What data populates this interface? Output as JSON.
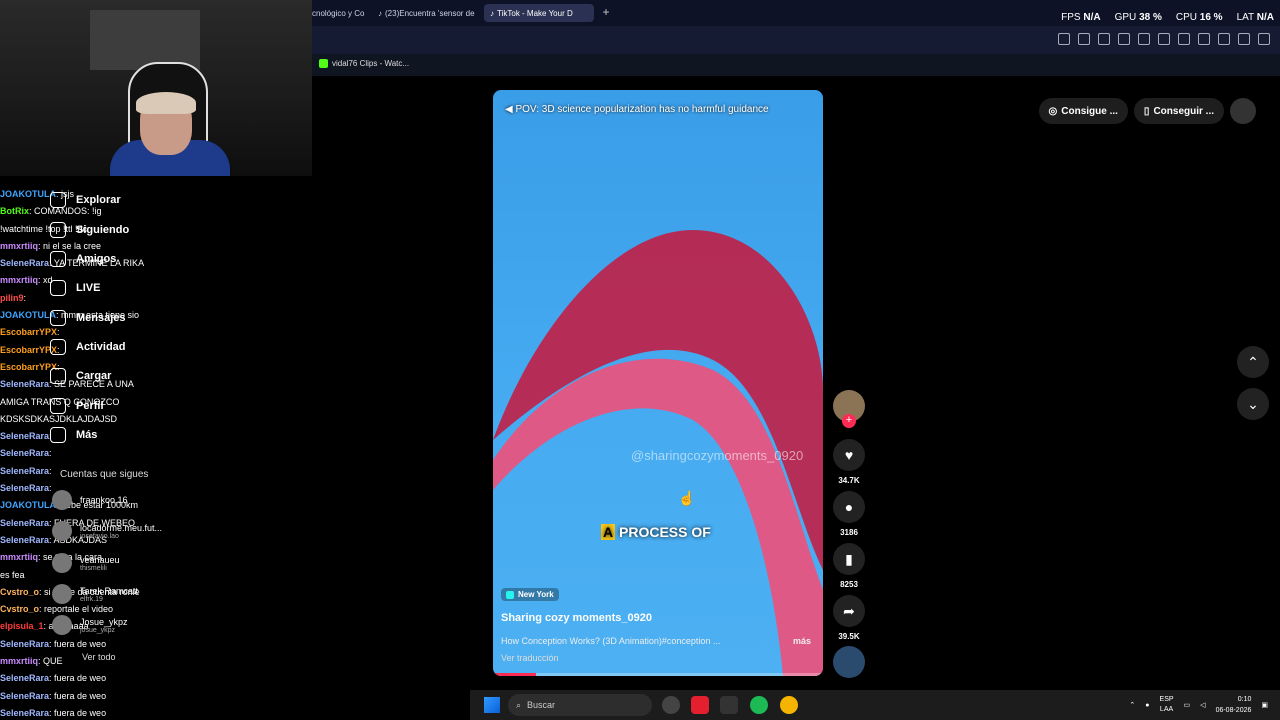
{
  "browser": {
    "tabs": [
      {
        "label": "cnológico y Co"
      },
      {
        "label": "(23)Encuentra 'sensor de"
      },
      {
        "label": "TikTok - Make Your D"
      }
    ],
    "stats": {
      "fps_label": "FPS",
      "fps": "N/A",
      "gpu_label": "GPU",
      "gpu": "38 %",
      "cpu_label": "CPU",
      "cpu": "16 %",
      "lat_label": "LAT",
      "lat": "N/A"
    },
    "bookmark": "vidal76 Clips - Watc..."
  },
  "chat": [
    {
      "user": "JOAKOTULA",
      "color": "#3fa6ff",
      "text": ": jsjs"
    },
    {
      "user": "BotRix",
      "color": "#53fc18",
      "text": ": COMANDOS: !ig"
    },
    {
      "user": "",
      "color": "#fff",
      "text": "!watchtime !top !ttl !dc"
    },
    {
      "user": "mmxrtiiq",
      "color": "#c98bff",
      "text": ": ni el se la cree"
    },
    {
      "user": "SeleneRara",
      "color": "#9fb8ff",
      "text": ": YA TERMINE LA RIKA"
    },
    {
      "user": "mmxrtiiq",
      "color": "#c98bff",
      "text": ": xd"
    },
    {
      "user": "pilin9",
      "color": "#ff4d4d",
      "text": ":"
    },
    {
      "user": "JOAKOTULA",
      "color": "#3fa6ff",
      "text": ": mmm esta tiene sio"
    },
    {
      "user": "EscobarrYPX",
      "color": "#ff9f1a",
      "text": ":"
    },
    {
      "user": "EscobarrYPX",
      "color": "#ff9f1a",
      "text": ":"
    },
    {
      "user": "EscobarrYPX",
      "color": "#ff9f1a",
      "text": ":"
    },
    {
      "user": "SeleneRara",
      "color": "#9fb8ff",
      "text": ": SE PARECE A UNA"
    },
    {
      "user": "",
      "color": "#fff",
      "text": "AMIGA TRANS Q CONOZCO"
    },
    {
      "user": "",
      "color": "#fff",
      "text": "KDSKSDKASJDKLAJDAJSD"
    },
    {
      "user": "SeleneRara",
      "color": "#9fb8ff",
      "text": ":"
    },
    {
      "user": "SeleneRara",
      "color": "#9fb8ff",
      "text": ":"
    },
    {
      "user": "SeleneRara",
      "color": "#9fb8ff",
      "text": ":"
    },
    {
      "user": "SeleneRara",
      "color": "#9fb8ff",
      "text": ":"
    },
    {
      "user": "JOAKOTULA",
      "color": "#3fa6ff",
      "text": ": debe estar 1000km"
    },
    {
      "user": "SeleneRara",
      "color": "#9fb8ff",
      "text": ": FUERA DE WEBEO"
    },
    {
      "user": "SeleneRara",
      "color": "#9fb8ff",
      "text": ": ASDKAJDAS"
    },
    {
      "user": "mmxrtiiq",
      "color": "#c98bff",
      "text": ": se tapa la cara"
    },
    {
      "user": "",
      "color": "#fff",
      "text": "es fea"
    },
    {
      "user": "Cvstro_o",
      "color": "#ffb35c",
      "text": ": si no se da cuenta ronie"
    },
    {
      "user": "Cvstro_o",
      "color": "#ffb35c",
      "text": ": reportale el video"
    },
    {
      "user": "elpisula_1",
      "color": "#ff3b3b",
      "text": ": aaaaaaaa"
    },
    {
      "user": "SeleneRara",
      "color": "#9fb8ff",
      "text": ": fuera de weo"
    },
    {
      "user": "mmxrtiiq",
      "color": "#c98bff",
      "text": ": QUE"
    },
    {
      "user": "SeleneRara",
      "color": "#9fb8ff",
      "text": ": fuera de weo"
    },
    {
      "user": "SeleneRara",
      "color": "#9fb8ff",
      "text": ": fuera de weo"
    },
    {
      "user": "SeleneRara",
      "color": "#9fb8ff",
      "text": ": fuera de weo"
    }
  ],
  "tiktok_nav": {
    "items": [
      "Explorar",
      "Siguiendo",
      "Amigos",
      "LIVE",
      "Mensajes",
      "Actividad",
      "Cargar",
      "Perfil",
      "Más"
    ],
    "following_title": "Cuentas que sigues",
    "accounts": [
      {
        "name": "fraankoo.16",
        "sub": ""
      },
      {
        "name": "locadorme.meu.fut...",
        "sub": "josefavio.lao"
      },
      {
        "name": "veanaueu",
        "sub": "thismelili"
      },
      {
        "name": "Tarek Ramcatt",
        "sub": "elfrk.19"
      },
      {
        "name": "Josue_ykpz",
        "sub": "josue_ykpz"
      }
    ],
    "see_all": "Ver todo"
  },
  "video": {
    "title": "POV: 3D science popularization has no harmful guidance",
    "watermark": "@sharingcozymoments_0920",
    "caption_highlight": "A",
    "caption_rest": "PROCESS OF",
    "location": "New York",
    "author": "Sharing cozy moments_0920",
    "description": "How Conception Works? (3D Animation)#conception ...",
    "more": "más",
    "translate": "Ver traducción",
    "progress": 0.13
  },
  "actions": {
    "likes": "34.7K",
    "comments": "3186",
    "saves": "8253",
    "shares": "39.5K"
  },
  "top_buttons": {
    "btn1": "Consigue ...",
    "btn2": "Conseguir ..."
  },
  "taskbar": {
    "search_placeholder": "Buscar",
    "lang_top": "ESP",
    "lang_bottom": "LAA",
    "time": "0:10",
    "date": "06-08-2026"
  }
}
